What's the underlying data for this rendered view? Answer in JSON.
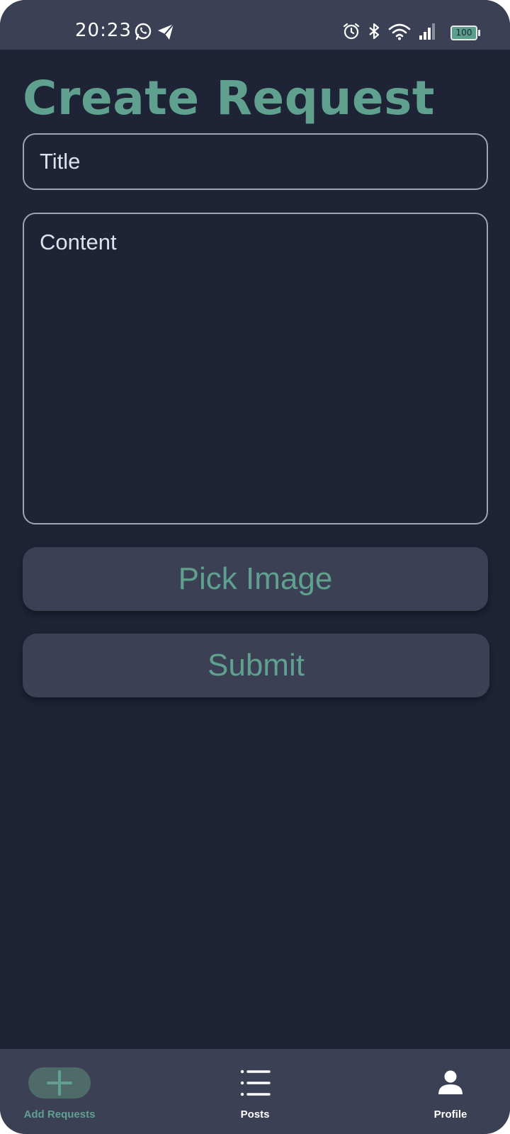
{
  "status_bar": {
    "time": "20:23",
    "battery_level": "100",
    "icons": [
      "whatsapp-icon",
      "telegram-icon",
      "alarm-icon",
      "bluetooth-icon",
      "wifi-icon",
      "signal-icon",
      "battery-icon"
    ]
  },
  "page": {
    "title": "Create Request"
  },
  "form": {
    "title_placeholder": "Title",
    "content_placeholder": "Content",
    "pick_image_label": "Pick Image",
    "submit_label": "Submit"
  },
  "bottom_nav": {
    "items": [
      {
        "label": "Add Requests",
        "icon": "plus-icon",
        "active": true
      },
      {
        "label": "Posts",
        "icon": "list-icon",
        "active": false
      },
      {
        "label": "Profile",
        "icon": "person-icon",
        "active": false
      }
    ]
  },
  "colors": {
    "background": "#1e2336",
    "surface": "#3b4054",
    "accent": "#5fa08e",
    "field_border": "#9ea2b1",
    "text": "#dfe1ea"
  }
}
